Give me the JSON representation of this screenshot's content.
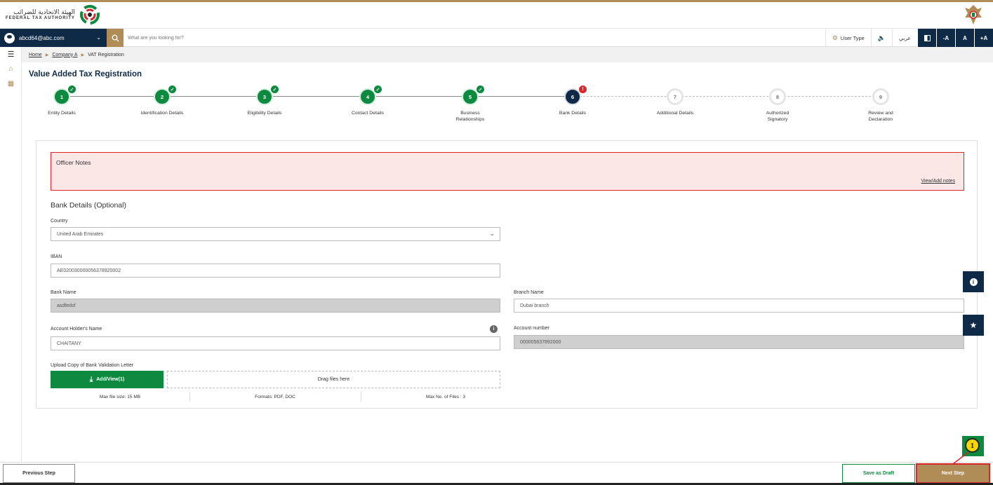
{
  "header": {
    "logo_arabic": "الهيئة الاتحادية للضرائب",
    "logo_english": "FEDERAL TAX AUTHORITY"
  },
  "toolbar": {
    "user_email": "abcd64@abc.com",
    "search_placeholder": "What are you looking for?",
    "user_type_label": "User Type",
    "arabic_label": "عربي",
    "font_smaller": "-A",
    "font_normal": "A",
    "font_larger": "+A"
  },
  "breadcrumb": {
    "home": "Home",
    "company": "Company A",
    "current": "VAT Registration"
  },
  "page_title": "Value Added Tax Registration",
  "steps": [
    {
      "number": "1",
      "label": "Entity Details",
      "status": "done"
    },
    {
      "number": "2",
      "label": "Identification Details",
      "status": "done"
    },
    {
      "number": "3",
      "label": "Eligibility Details",
      "status": "done"
    },
    {
      "number": "4",
      "label": "Contact Details",
      "status": "done"
    },
    {
      "number": "5",
      "label": "Business Relationships",
      "status": "done"
    },
    {
      "number": "6",
      "label": "Bank Details",
      "status": "active"
    },
    {
      "number": "7",
      "label": "Additional Details",
      "status": "todo"
    },
    {
      "number": "8",
      "label": "Authorized Signatory",
      "status": "todo"
    },
    {
      "number": "9",
      "label": "Review and Declaration",
      "status": "todo"
    }
  ],
  "officer_notes": {
    "title": "Officer Notes",
    "link": "View/Add notes"
  },
  "bank_section": {
    "title": "Bank Details (Optional)",
    "country_label": "Country",
    "country_value": "United Arab Emirates",
    "iban_label": "IBAN",
    "iban_value": "AE020030000056378920002",
    "bank_name_label": "Bank Name",
    "bank_name_value": "asdfedsf",
    "branch_name_label": "Branch Name",
    "branch_name_value": "Dubai branch",
    "holder_label": "Account Holder's Name",
    "holder_value": "CHAITANY",
    "account_number_label": "Account number",
    "account_number_value": "000005637892000",
    "upload_label": "Upload Copy of Bank Validation Letter",
    "add_view_label": "Add/View(1)",
    "drag_label": "Drag files here",
    "max_size": "Max file size: 15 MB",
    "formats": "Formats: PDF, DOC",
    "max_files": "Max No. of Files : 3"
  },
  "footer": {
    "previous": "Previous Step",
    "save_draft": "Save as Draft",
    "next": "Next Step"
  },
  "annotation": {
    "callout_number": "1"
  },
  "colors": {
    "navy": "#0e2a47",
    "gold": "#b08d57",
    "green": "#0d8a3f",
    "red": "#e0242b"
  }
}
